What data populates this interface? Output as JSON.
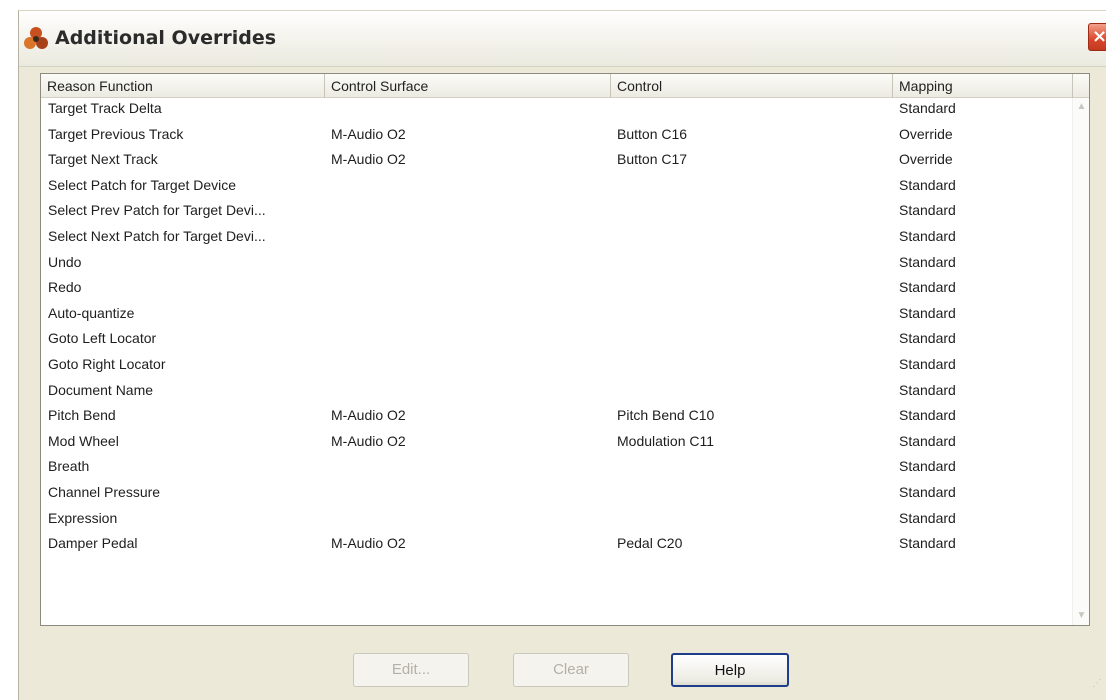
{
  "window": {
    "title": "Additional Overrides",
    "close_glyph": "×",
    "app_icon": "reason-app-icon",
    "close_icon": "close-icon"
  },
  "list": {
    "columns": [
      "Reason Function",
      "Control Surface",
      "Control",
      "Mapping"
    ],
    "rows": [
      {
        "function": "Target Track Delta",
        "surface": "",
        "control": "",
        "mapping": "Standard"
      },
      {
        "function": "Target Previous Track",
        "surface": "M-Audio O2",
        "control": "Button C16",
        "mapping": "Override"
      },
      {
        "function": "Target Next Track",
        "surface": "M-Audio O2",
        "control": "Button C17",
        "mapping": "Override"
      },
      {
        "function": "Select Patch for Target Device",
        "surface": "",
        "control": "",
        "mapping": "Standard"
      },
      {
        "function": "Select Prev Patch for Target Devi...",
        "surface": "",
        "control": "",
        "mapping": "Standard"
      },
      {
        "function": "Select Next Patch for Target Devi...",
        "surface": "",
        "control": "",
        "mapping": "Standard"
      },
      {
        "function": "Undo",
        "surface": "",
        "control": "",
        "mapping": "Standard"
      },
      {
        "function": "Redo",
        "surface": "",
        "control": "",
        "mapping": "Standard"
      },
      {
        "function": "Auto-quantize",
        "surface": "",
        "control": "",
        "mapping": "Standard"
      },
      {
        "function": "Goto Left Locator",
        "surface": "",
        "control": "",
        "mapping": "Standard"
      },
      {
        "function": "Goto Right Locator",
        "surface": "",
        "control": "",
        "mapping": "Standard"
      },
      {
        "function": "Document Name",
        "surface": "",
        "control": "",
        "mapping": "Standard"
      },
      {
        "function": "Pitch Bend",
        "surface": "M-Audio O2",
        "control": "Pitch Bend C10",
        "mapping": "Standard"
      },
      {
        "function": "Mod Wheel",
        "surface": "M-Audio O2",
        "control": "Modulation C11",
        "mapping": "Standard"
      },
      {
        "function": "Breath",
        "surface": "",
        "control": "",
        "mapping": "Standard"
      },
      {
        "function": "Channel Pressure",
        "surface": "",
        "control": "",
        "mapping": "Standard"
      },
      {
        "function": "Expression",
        "surface": "",
        "control": "",
        "mapping": "Standard"
      },
      {
        "function": "Damper Pedal",
        "surface": "M-Audio O2",
        "control": "Pedal C20",
        "mapping": "Standard"
      }
    ],
    "scroll_up_glyph": "▲",
    "scroll_down_glyph": "▼"
  },
  "buttons": {
    "edit": "Edit...",
    "clear": "Clear",
    "help": "Help"
  },
  "sizegrip_glyph": "⋰",
  "colors": {
    "dialog_bg": "#ece9d8",
    "close_button": "#d9472b",
    "default_button_border": "#1f3d8a"
  }
}
